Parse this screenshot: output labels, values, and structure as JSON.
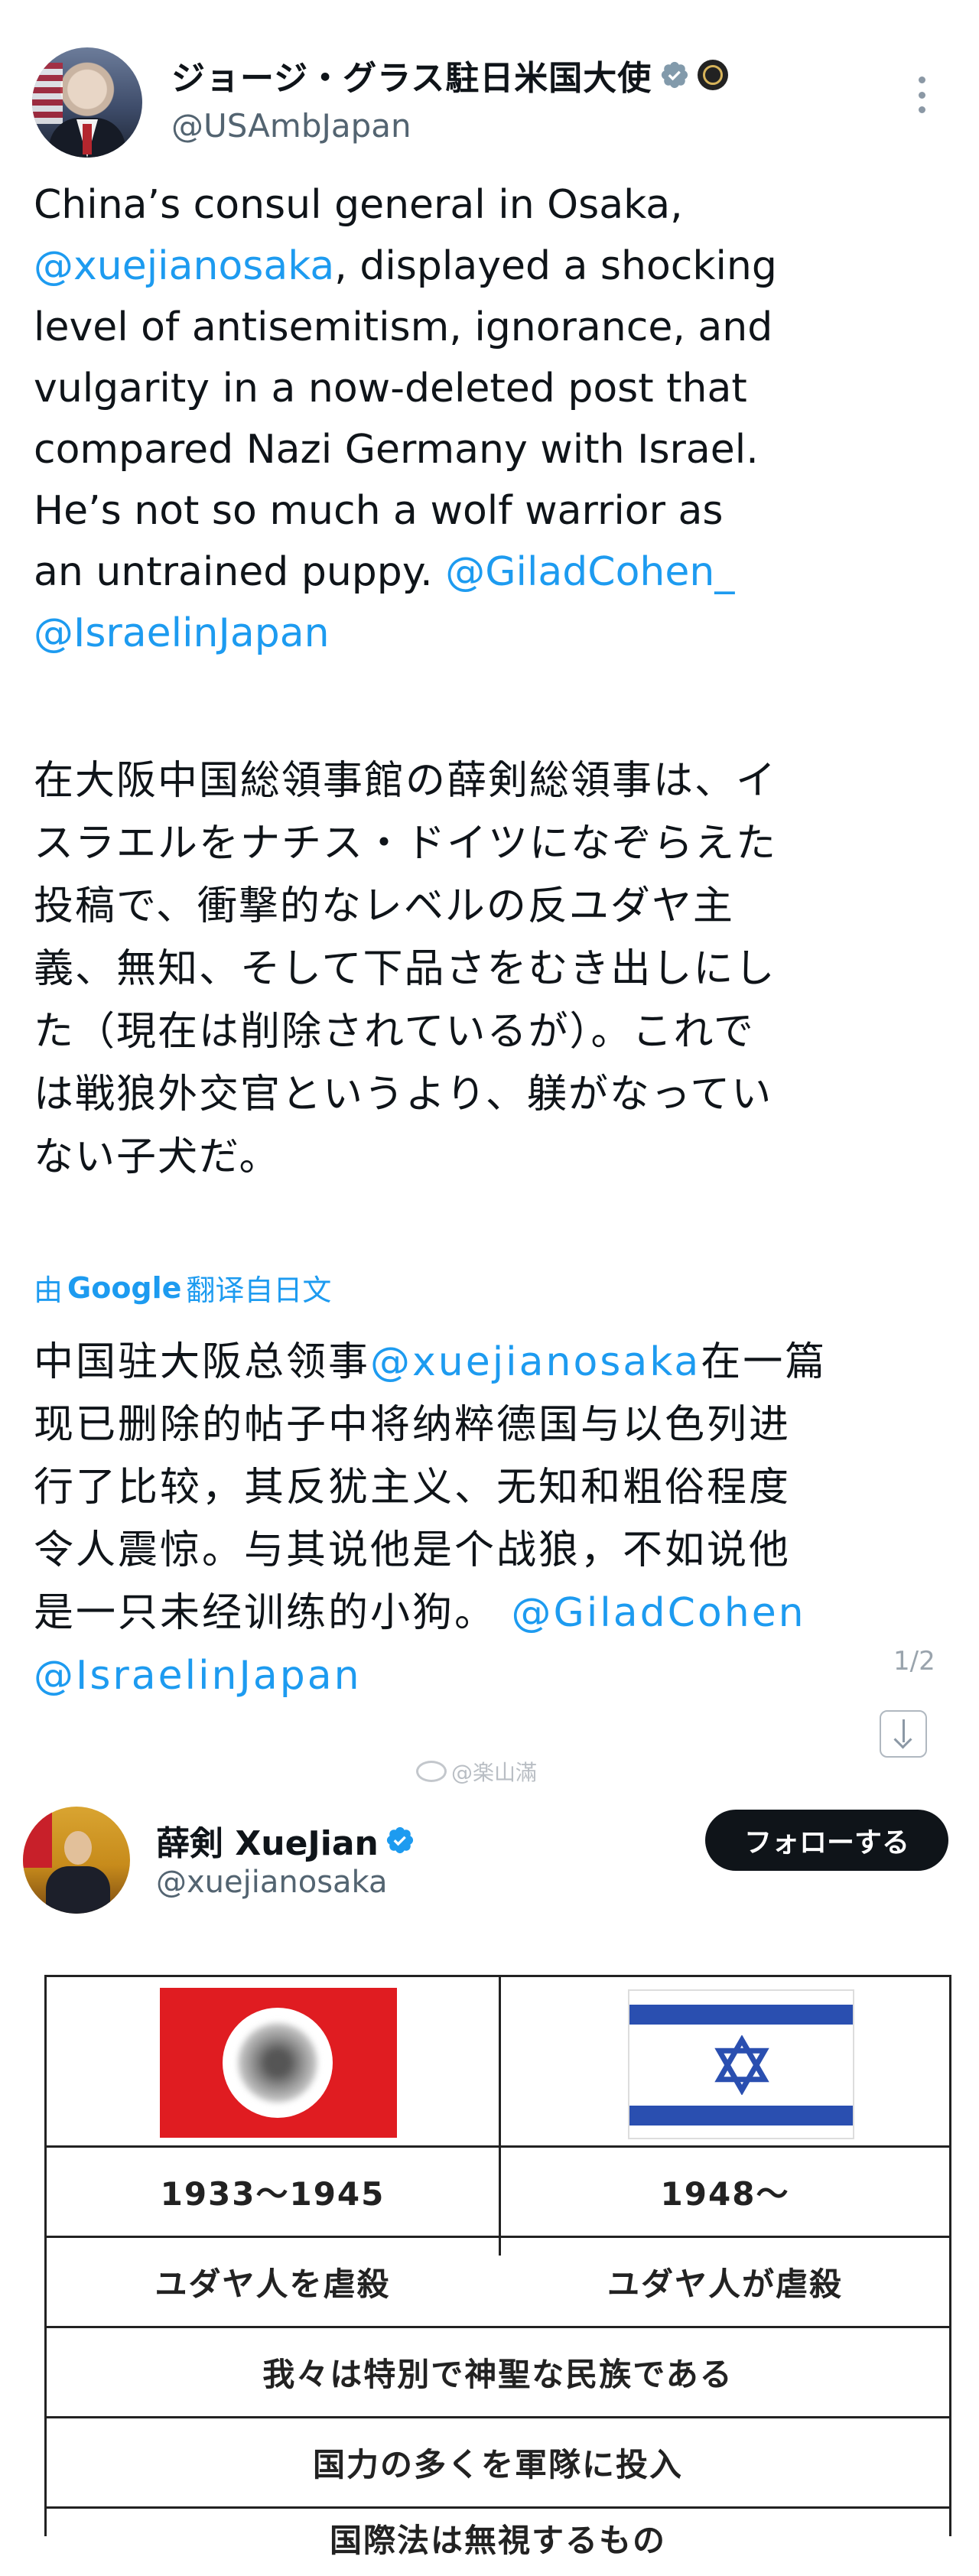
{
  "tweet1": {
    "author_name": "ジョージ・グラス駐日米国大使",
    "handle": "@USAmbJapan",
    "english_lines": [
      "China’s consul general in Osaka,",
      "@xuejianosaka, displayed a shocking",
      "level of antisemitism, ignorance, and",
      "vulgarity in a now-deleted post that",
      "compared Nazi Germany with Israel.",
      "He’s not so much a wolf warrior as",
      "an untrained puppy.",
      "@GiladCohen_",
      "@IsraelinJapan"
    ],
    "english_line2_rest": ", displayed a shocking",
    "mention_xuejian": "@xuejianosaka",
    "english_line1": "China’s consul general in Osaka,",
    "japanese_lines": [
      "在大阪中国総領事館の薛剣総領事は、イ",
      "スラエルをナチス・ドイツになぞらえた",
      "投稿で、衝撃的なレベルの反ユダヤ主",
      "義、無知、そして下品さをむき出しにし",
      "た（現在は削除されているが）。これで",
      "は戦狼外交官というより、躾がなってい",
      "ない子犬だ。"
    ],
    "translate_prefix": "由",
    "translate_google": "Google",
    "translate_suffix": "翻译自日文",
    "chinese_lines": {
      "l1_a": "中国驻大阪总领事",
      "l1_mention": "@xuejianosaka",
      "l1_b": "在一篇",
      "l2": "现已删除的帖子中将纳粹德国与以色列进",
      "l3": "行了比较，其反犹主义、无知和粗俗程度",
      "l4": "令人震惊。与其说他是个战狼，不如说他",
      "l5_a": "是一只未经训练的小狗。",
      "l5_mention": "@GiladCohen",
      "l6_mention": "@IsraelinJapan"
    },
    "page_indicator": "1/2",
    "watermark": "@楽山滿"
  },
  "tweet2": {
    "author_name": "薛剣 XueJian",
    "handle": "@xuejianosaka",
    "follow_label": "フォローする"
  },
  "comparison_table": {
    "left_years": "1933〜1945",
    "right_years": "1948〜",
    "left_row2": "ユダヤ人を虐殺",
    "right_row2": "ユダヤ人が虐殺",
    "row3": "我々は特別で神聖な民族である",
    "row4": "国力の多くを軍隊に投入",
    "row5_partial": "国際法は無視するもの"
  },
  "colors": {
    "link": "#1d9bf0",
    "verified": "#1d9bf0",
    "nazi_red": "#e01c21",
    "israel_blue": "#2a4fb0"
  }
}
